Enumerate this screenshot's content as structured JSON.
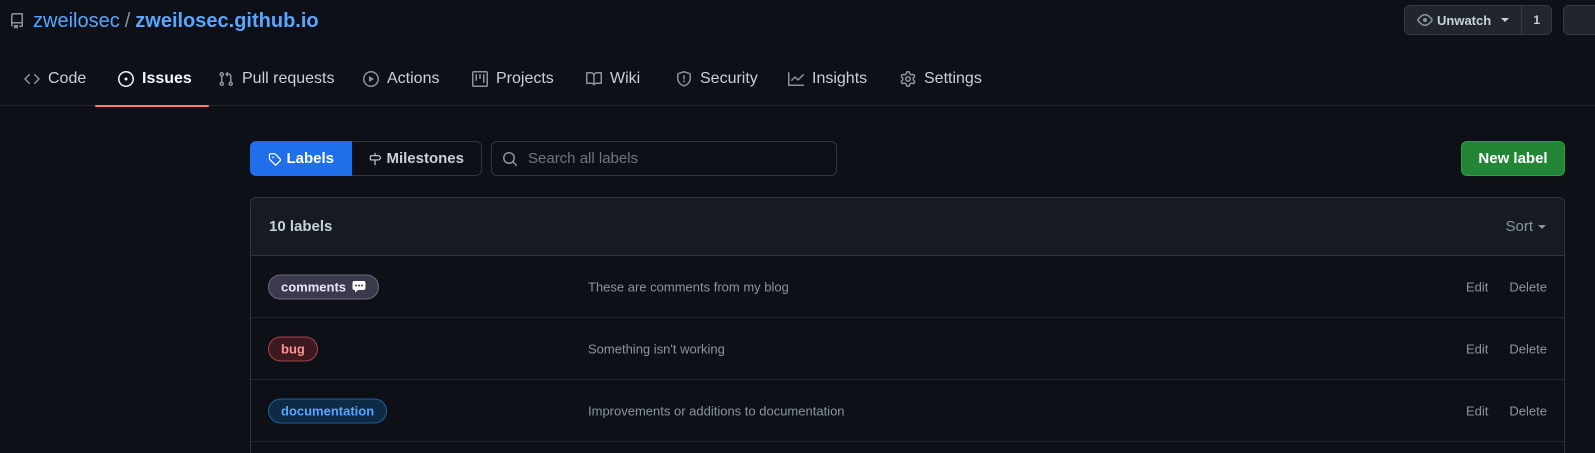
{
  "repo": {
    "owner": "zweilosec",
    "separator": "/",
    "name": "zweilosec.github.io"
  },
  "watch": {
    "label": "Unwatch",
    "count": "1"
  },
  "tabs": [
    {
      "label": "Code",
      "icon": "code-icon"
    },
    {
      "label": "Issues",
      "icon": "issue-opened-icon",
      "active": true
    },
    {
      "label": "Pull requests",
      "icon": "git-pull-request-icon"
    },
    {
      "label": "Actions",
      "icon": "play-icon"
    },
    {
      "label": "Projects",
      "icon": "project-icon"
    },
    {
      "label": "Wiki",
      "icon": "book-icon"
    },
    {
      "label": "Security",
      "icon": "shield-icon"
    },
    {
      "label": "Insights",
      "icon": "graph-icon"
    },
    {
      "label": "Settings",
      "icon": "gear-icon"
    }
  ],
  "subnav": {
    "labels": "Labels",
    "milestones": "Milestones"
  },
  "search": {
    "placeholder": "Search all labels",
    "value": ""
  },
  "new_label_button": "New label",
  "labels_box": {
    "count_text": "10 labels",
    "sort_label": "Sort",
    "edit_text": "Edit",
    "delete_text": "Delete",
    "rows": [
      {
        "name": "comments",
        "description": "These are comments from my blog",
        "emoji": "speech-balloon-icon"
      },
      {
        "name": "bug",
        "description": "Something isn't working"
      },
      {
        "name": "documentation",
        "description": "Improvements or additions to documentation"
      }
    ]
  },
  "colors": {
    "background": "#0d1117",
    "link": "#58a6ff",
    "active_tab_underline": "#f78166",
    "selected_subnav": "#1f6feb",
    "new_label_green": "#238636"
  }
}
